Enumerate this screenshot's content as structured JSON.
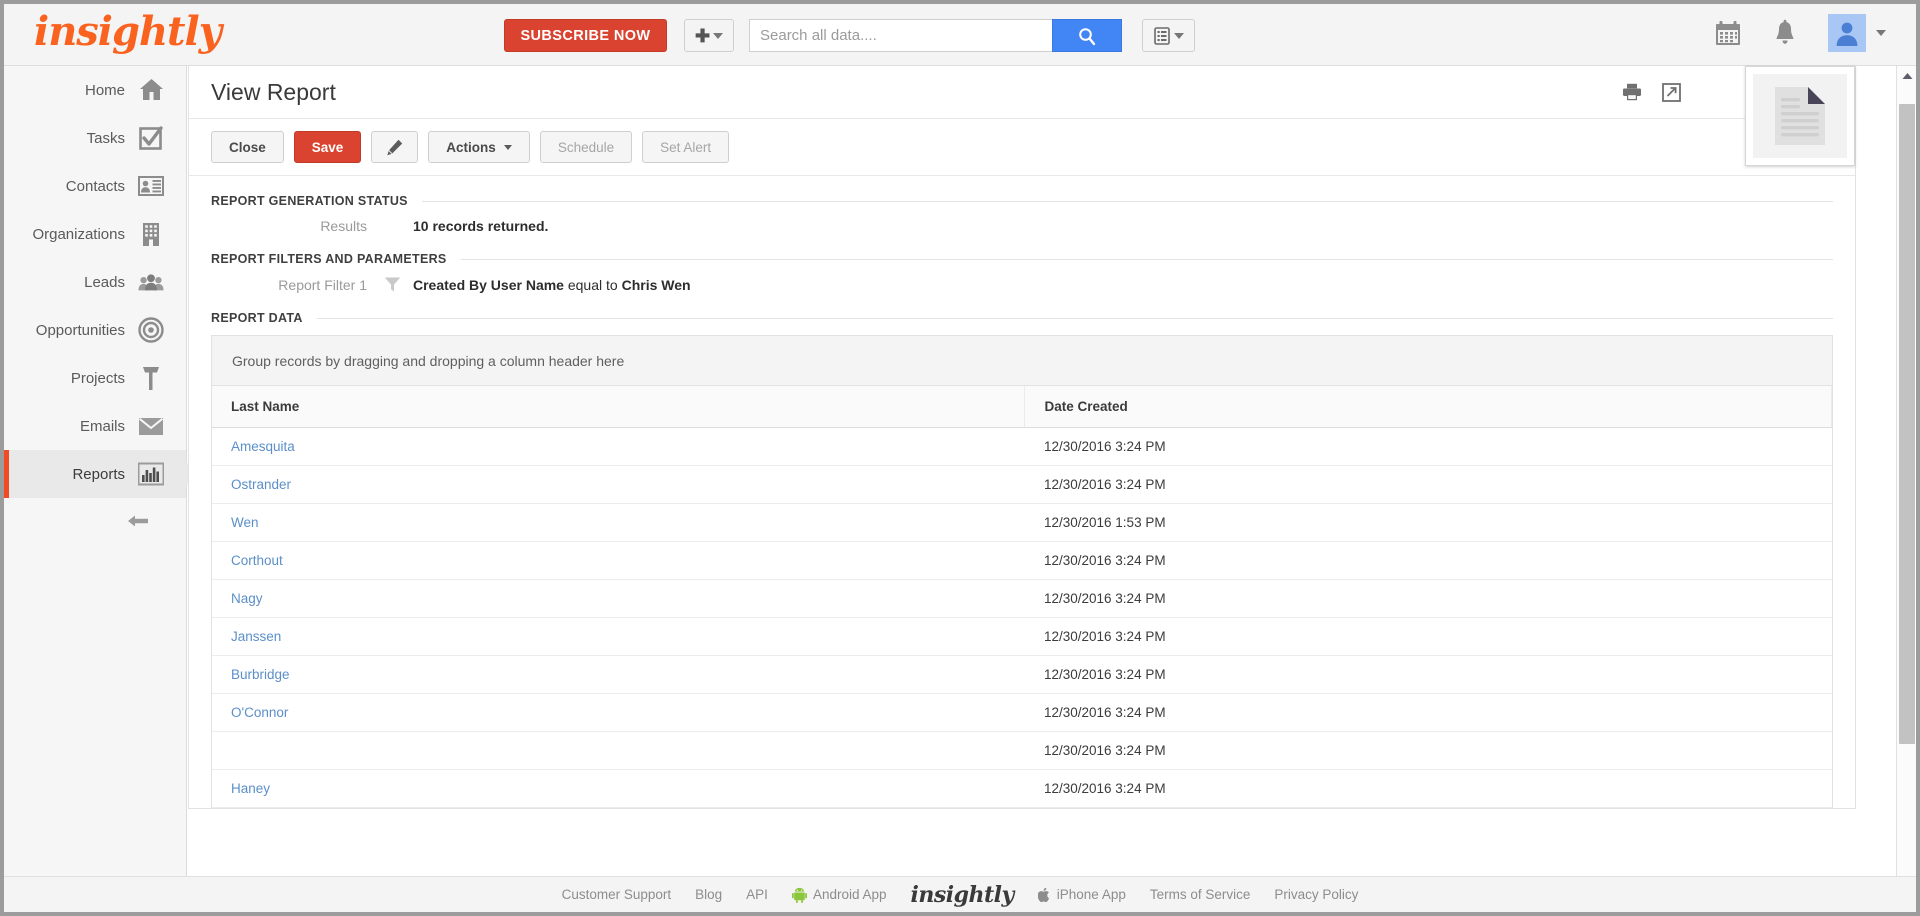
{
  "topbar": {
    "logo": "insightly",
    "subscribe_label": "SUBSCRIBE NOW",
    "add_icon": "plus-icon",
    "search_placeholder": "Search all data....",
    "search_value": "",
    "search_icon": "search-icon",
    "report_select_icon": "list-icon",
    "calendar_icon": "calendar-icon",
    "notification_icon": "bell-icon",
    "avatar_icon": "user-avatar-icon",
    "colors": {
      "accent_orange": "#f9621f",
      "subscribe_red": "#d9432f",
      "search_blue": "#4285f4",
      "avatar_blue": "#a9c7f5"
    }
  },
  "sidebar": {
    "items": [
      {
        "label": "Home",
        "icon": "home-icon",
        "active": false
      },
      {
        "label": "Tasks",
        "icon": "task-check-icon",
        "active": false
      },
      {
        "label": "Contacts",
        "icon": "contact-card-icon",
        "active": false
      },
      {
        "label": "Organizations",
        "icon": "building-icon",
        "active": false
      },
      {
        "label": "Leads",
        "icon": "people-icon",
        "active": false
      },
      {
        "label": "Opportunities",
        "icon": "target-icon",
        "active": false
      },
      {
        "label": "Projects",
        "icon": "hammer-icon",
        "active": false
      },
      {
        "label": "Emails",
        "icon": "envelope-icon",
        "active": false
      },
      {
        "label": "Reports",
        "icon": "bar-chart-icon",
        "active": true
      }
    ],
    "collapse_icon": "arrow-left-icon",
    "active_marker_color": "#f04b24"
  },
  "card": {
    "title": "View Report",
    "header_icons": [
      {
        "name": "print-icon"
      },
      {
        "name": "open-in-new-window-icon"
      }
    ],
    "toolbar": {
      "close_label": "Close",
      "save_label": "Save",
      "edit_icon": "pencil-icon",
      "actions_label": "Actions",
      "schedule_label": "Schedule",
      "set_alert_label": "Set Alert"
    }
  },
  "sections": {
    "generation_status": {
      "heading": "REPORT GENERATION STATUS",
      "results_label": "Results",
      "results_value": "10 records returned."
    },
    "filters": {
      "heading": "REPORT FILTERS AND PARAMETERS",
      "filter_label": "Report Filter 1",
      "filter_icon": "funnel-icon",
      "filter_field": "Created By User Name",
      "filter_operator": "equal to",
      "filter_value": "Chris Wen"
    },
    "report_data": {
      "heading": "REPORT DATA",
      "group_zone_text": "Group records by dragging and dropping a column header here"
    }
  },
  "grid": {
    "columns": [
      "Last Name",
      "Date Created"
    ],
    "rows": [
      {
        "last_name": "Amesquita",
        "date_created": "12/30/2016 3:24 PM"
      },
      {
        "last_name": "Ostrander",
        "date_created": "12/30/2016 3:24 PM"
      },
      {
        "last_name": "Wen",
        "date_created": "12/30/2016 1:53 PM"
      },
      {
        "last_name": "Corthout",
        "date_created": "12/30/2016 3:24 PM"
      },
      {
        "last_name": "Nagy",
        "date_created": "12/30/2016 3:24 PM"
      },
      {
        "last_name": "Janssen",
        "date_created": "12/30/2016 3:24 PM"
      },
      {
        "last_name": "Burbridge",
        "date_created": "12/30/2016 3:24 PM"
      },
      {
        "last_name": "O'Connor",
        "date_created": "12/30/2016 3:24 PM"
      },
      {
        "last_name": "",
        "date_created": "12/30/2016 3:24 PM"
      },
      {
        "last_name": "Haney",
        "date_created": "12/30/2016 3:24 PM"
      }
    ]
  },
  "drag_preview": {
    "icon": "document-page-icon"
  },
  "scrollbar": {
    "up_icon": "scroll-up-arrow-icon",
    "down_icon": "scroll-down-arrow-icon"
  },
  "footer": {
    "links": [
      {
        "label": "Customer Support",
        "icon": ""
      },
      {
        "label": "Blog",
        "icon": ""
      },
      {
        "label": "API",
        "icon": ""
      },
      {
        "label": "Android App",
        "icon": "android-icon"
      }
    ],
    "logo": "insightly",
    "links_right": [
      {
        "label": "iPhone App",
        "icon": "apple-icon"
      },
      {
        "label": "Terms of Service",
        "icon": ""
      },
      {
        "label": "Privacy Policy",
        "icon": ""
      }
    ]
  }
}
